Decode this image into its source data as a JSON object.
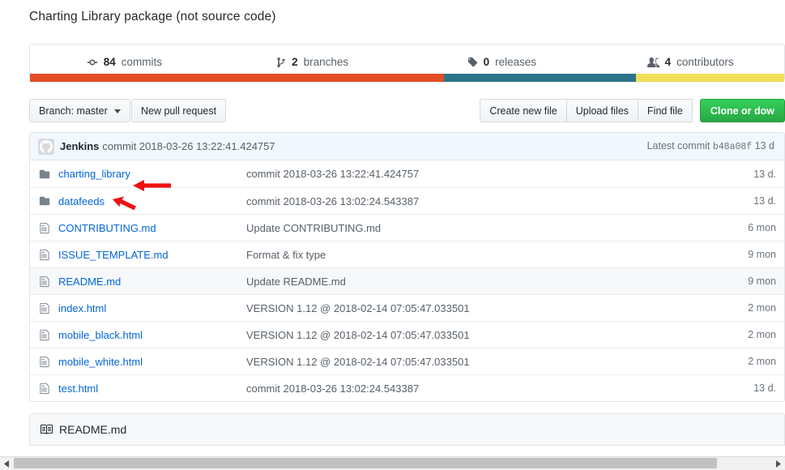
{
  "repo": {
    "description": "Charting Library package (not source code)"
  },
  "stats": [
    {
      "icon": "commit-icon",
      "number": "84",
      "label": "commits"
    },
    {
      "icon": "branch-icon",
      "number": "2",
      "label": "branches"
    },
    {
      "icon": "tag-icon",
      "number": "0",
      "label": "releases"
    },
    {
      "icon": "people-icon",
      "number": "4",
      "label": "contributors"
    }
  ],
  "language_bar": [
    {
      "name": "lang-segment-1",
      "color": "#e44d26",
      "percent": 54.9
    },
    {
      "name": "lang-segment-2",
      "color": "#2b7489",
      "percent": 25.4
    },
    {
      "name": "lang-segment-3",
      "color": "#f1e05a",
      "percent": 19.7
    }
  ],
  "toolbar": {
    "branch_label": "Branch: master",
    "new_pull_request": "New pull request",
    "create_new_file": "Create new file",
    "upload_files": "Upload files",
    "find_file": "Find file",
    "clone_or_download": "Clone or dow"
  },
  "commit_bar": {
    "author": "Jenkins",
    "message": "commit 2018-03-26 13:22:41.424757",
    "latest_prefix": "Latest commit",
    "sha": "b48a08f",
    "latest_time": "13 d"
  },
  "file_table": {
    "rows": [
      {
        "type": "directory",
        "icon": "folder-icon",
        "name": "charting_library",
        "message": "commit 2018-03-26 13:22:41.424757",
        "time": "13 d.",
        "highlight": false
      },
      {
        "type": "directory",
        "icon": "folder-icon",
        "name": "datafeeds",
        "message": "commit 2018-03-26 13:02:24.543387",
        "time": "13 d.",
        "highlight": false
      },
      {
        "type": "file",
        "icon": "file-icon",
        "name": "CONTRIBUTING.md",
        "message": "Update CONTRIBUTING.md",
        "time": "6 mon",
        "highlight": false
      },
      {
        "type": "file",
        "icon": "file-icon",
        "name": "ISSUE_TEMPLATE.md",
        "message": "Format & fix type",
        "time": "9 mon",
        "highlight": false
      },
      {
        "type": "file",
        "icon": "file-icon",
        "name": "README.md",
        "message": "Update README.md",
        "time": "9 mon",
        "highlight": true
      },
      {
        "type": "file",
        "icon": "file-icon",
        "name": "index.html",
        "message": "VERSION 1.12 @ 2018-02-14 07:05:47.033501",
        "time": "2 mon",
        "highlight": false
      },
      {
        "type": "file",
        "icon": "file-icon",
        "name": "mobile_black.html",
        "message": "VERSION 1.12 @ 2018-02-14 07:05:47.033501",
        "time": "2 mon",
        "highlight": false
      },
      {
        "type": "file",
        "icon": "file-icon",
        "name": "mobile_white.html",
        "message": "VERSION 1.12 @ 2018-02-14 07:05:47.033501",
        "time": "2 mon",
        "highlight": false
      },
      {
        "type": "file",
        "icon": "file-icon",
        "name": "test.html",
        "message": "commit 2018-03-26 13:02:24.543387",
        "time": "13 d.",
        "highlight": false
      }
    ]
  },
  "readme_footer": {
    "icon": "book-icon",
    "title": "README.md"
  },
  "annotations": {
    "color": "#ee1111",
    "arrows": [
      {
        "name": "annotation-arrow-charting-library",
        "target": "charting_library"
      },
      {
        "name": "annotation-arrow-datafeeds",
        "target": "datafeeds"
      }
    ]
  },
  "scrollbar": {
    "orientation": "horizontal",
    "left_arrow": "◂",
    "right_arrow": "▸"
  }
}
